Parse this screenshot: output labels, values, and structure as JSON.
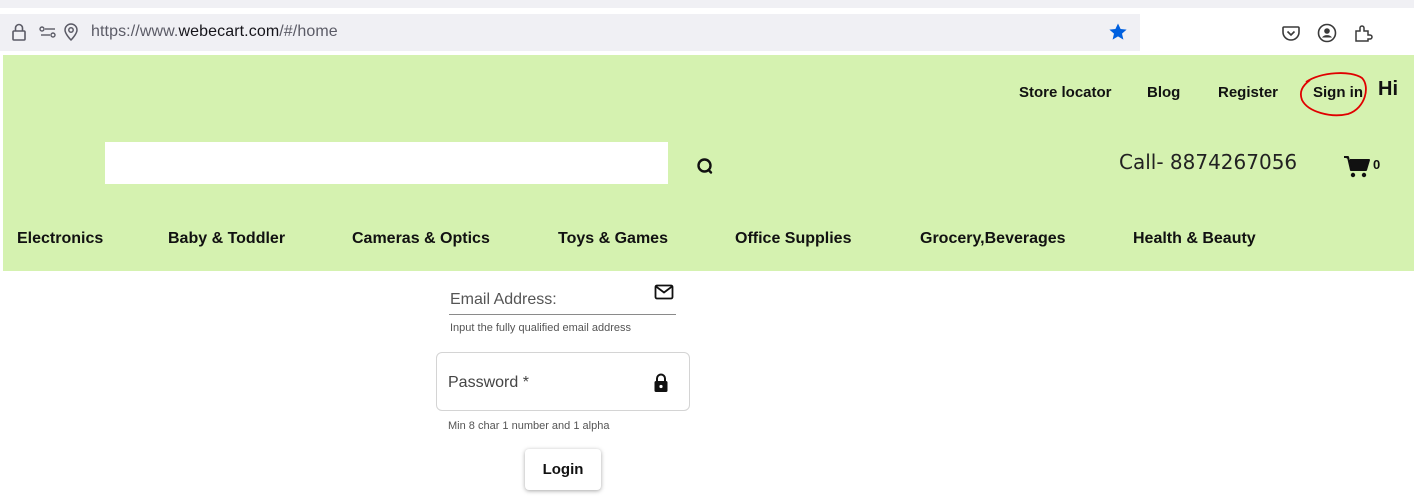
{
  "browser": {
    "url_prefix": "https://www.",
    "url_domain": "webecart.com",
    "url_suffix": "/#/home",
    "icons": [
      "lock-icon",
      "permissions-icon",
      "location-icon",
      "bookmark-star-icon",
      "pocket-icon",
      "account-icon",
      "extensions-icon"
    ],
    "accent_color": "#0060df"
  },
  "header": {
    "background_color": "#d5f2b0",
    "top_links": [
      "Store locator",
      "Blog",
      "Register",
      "Sign in"
    ],
    "greeting": "Hi",
    "search": {
      "value": "",
      "placeholder": ""
    },
    "call": "Call- 8874267056",
    "cart_count": "0",
    "annotation_color": "#e00000"
  },
  "nav": {
    "categories": [
      "Electronics",
      "Baby & Toddler",
      "Cameras & Optics",
      "Toys & Games",
      "Office Supplies",
      "Grocery,Beverages",
      "Health & Beauty"
    ]
  },
  "login_form": {
    "email_label": "Email Address:",
    "email_hint": "Input the fully qualified email address",
    "password_label": "Password *",
    "password_hint": "Min 8 char 1 number and 1 alpha",
    "login_label": "Login"
  }
}
